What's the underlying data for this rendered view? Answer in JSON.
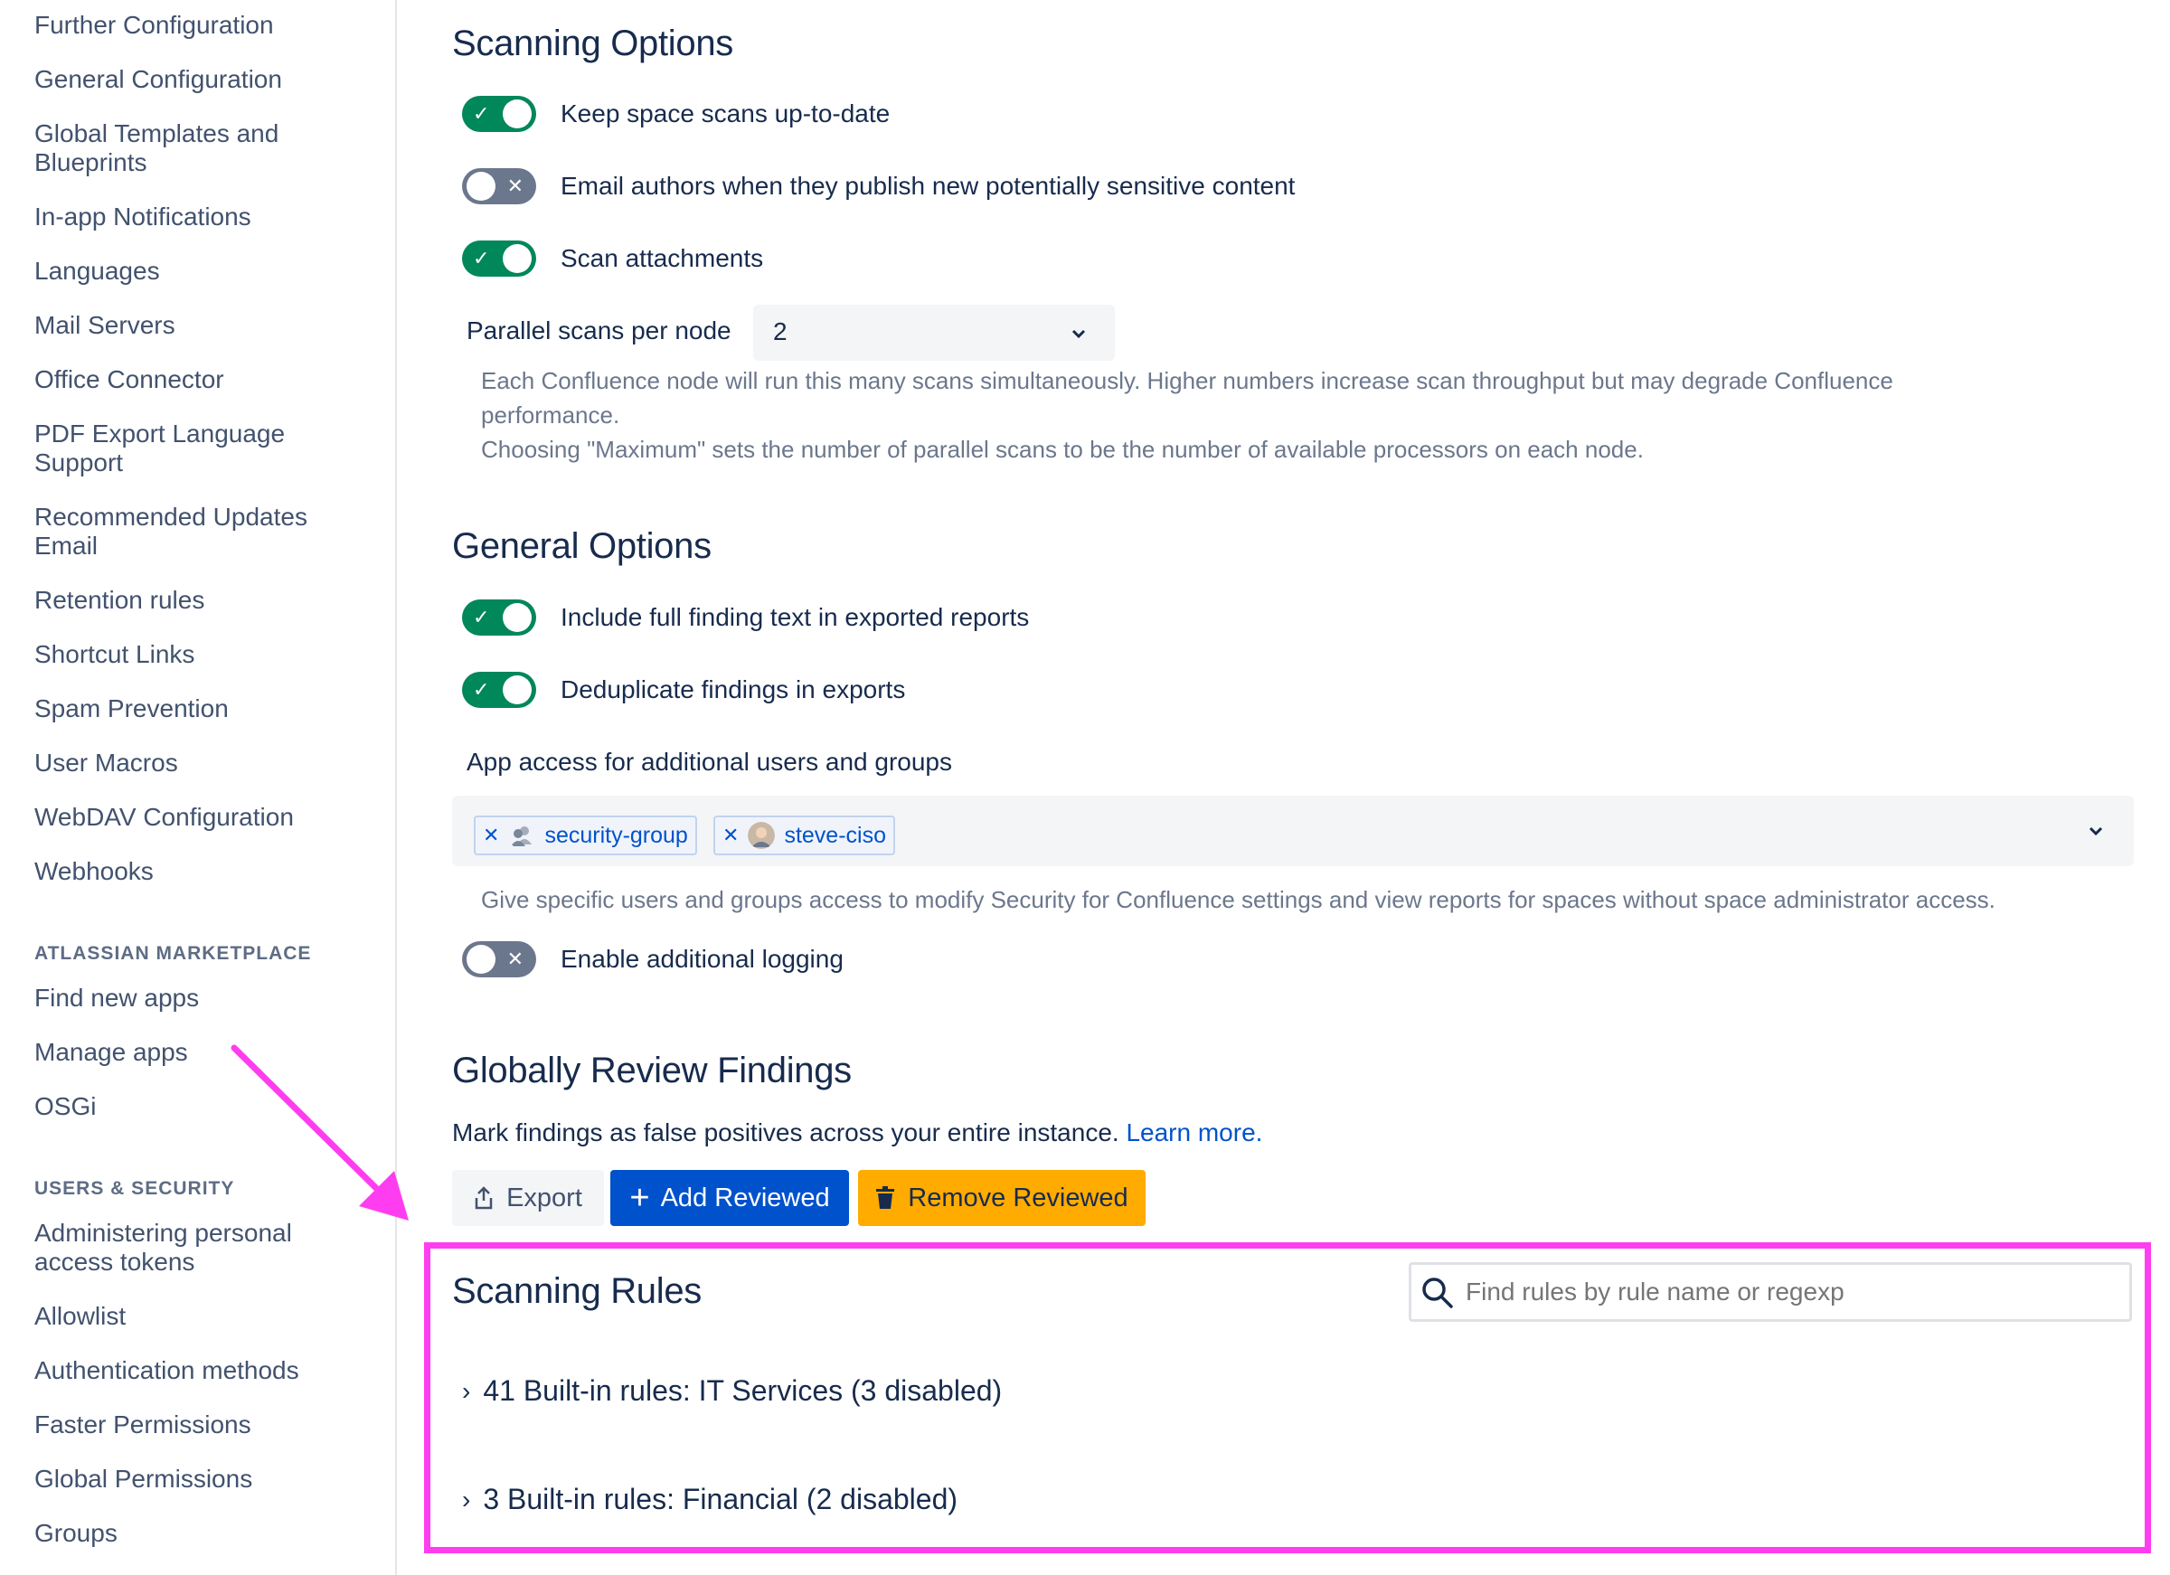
{
  "sidebar": {
    "items": [
      "Further Configuration",
      "General Configuration",
      "Global Templates and Blueprints",
      "In-app Notifications",
      "Languages",
      "Mail Servers",
      "Office Connector",
      "PDF Export Language Support",
      "Recommended Updates Email",
      "Retention rules",
      "Shortcut Links",
      "Spam Prevention",
      "User Macros",
      "WebDAV Configuration",
      "Webhooks"
    ],
    "marketplace_heading": "ATLASSIAN MARKETPLACE",
    "marketplace_items": [
      "Find new apps",
      "Manage apps",
      "OSGi"
    ],
    "security_heading": "USERS & SECURITY",
    "security_items": [
      "Administering personal access tokens",
      "Allowlist",
      "Authentication methods",
      "Faster Permissions",
      "Global Permissions",
      "Groups"
    ]
  },
  "scanning_options": {
    "title": "Scanning Options",
    "keep_scans": "Keep space scans up-to-date",
    "email_authors": "Email authors when they publish new potentially sensitive content",
    "scan_attachments": "Scan attachments",
    "parallel_label": "Parallel scans per node",
    "parallel_value": "2",
    "help_line1": "Each Confluence node will run this many scans simultaneously. Higher numbers increase scan throughput but may degrade Confluence",
    "help_line2": "performance.",
    "help_line3": "Choosing \"Maximum\" sets the number of parallel scans to be the number of available processors on each node."
  },
  "general_options": {
    "title": "General Options",
    "full_text": "Include full finding text in exported reports",
    "dedupe": "Deduplicate findings in exports",
    "access_label": "App access for additional users and groups",
    "tags": [
      "security-group",
      "steve-ciso"
    ],
    "access_help": "Give specific users and groups access to modify Security for Confluence settings and view reports for spaces without space administrator access.",
    "logging": "Enable additional logging"
  },
  "review": {
    "title": "Globally Review Findings",
    "text": "Mark findings as false positives across your entire instance.",
    "learn_more": "Learn more.",
    "export": "Export",
    "add": "Add Reviewed",
    "remove": "Remove Reviewed"
  },
  "rules": {
    "title": "Scanning Rules",
    "search_placeholder": "Find rules by rule name or regexp",
    "groups": [
      "41 Built-in rules: IT Services (3 disabled)",
      "3 Built-in rules: Financial (2 disabled)"
    ]
  },
  "colors": {
    "toggle_on": "#00875a",
    "toggle_off": "#6b778c",
    "primary": "#0052cc",
    "warning": "#ffab00",
    "annotation": "#ff3df0"
  }
}
